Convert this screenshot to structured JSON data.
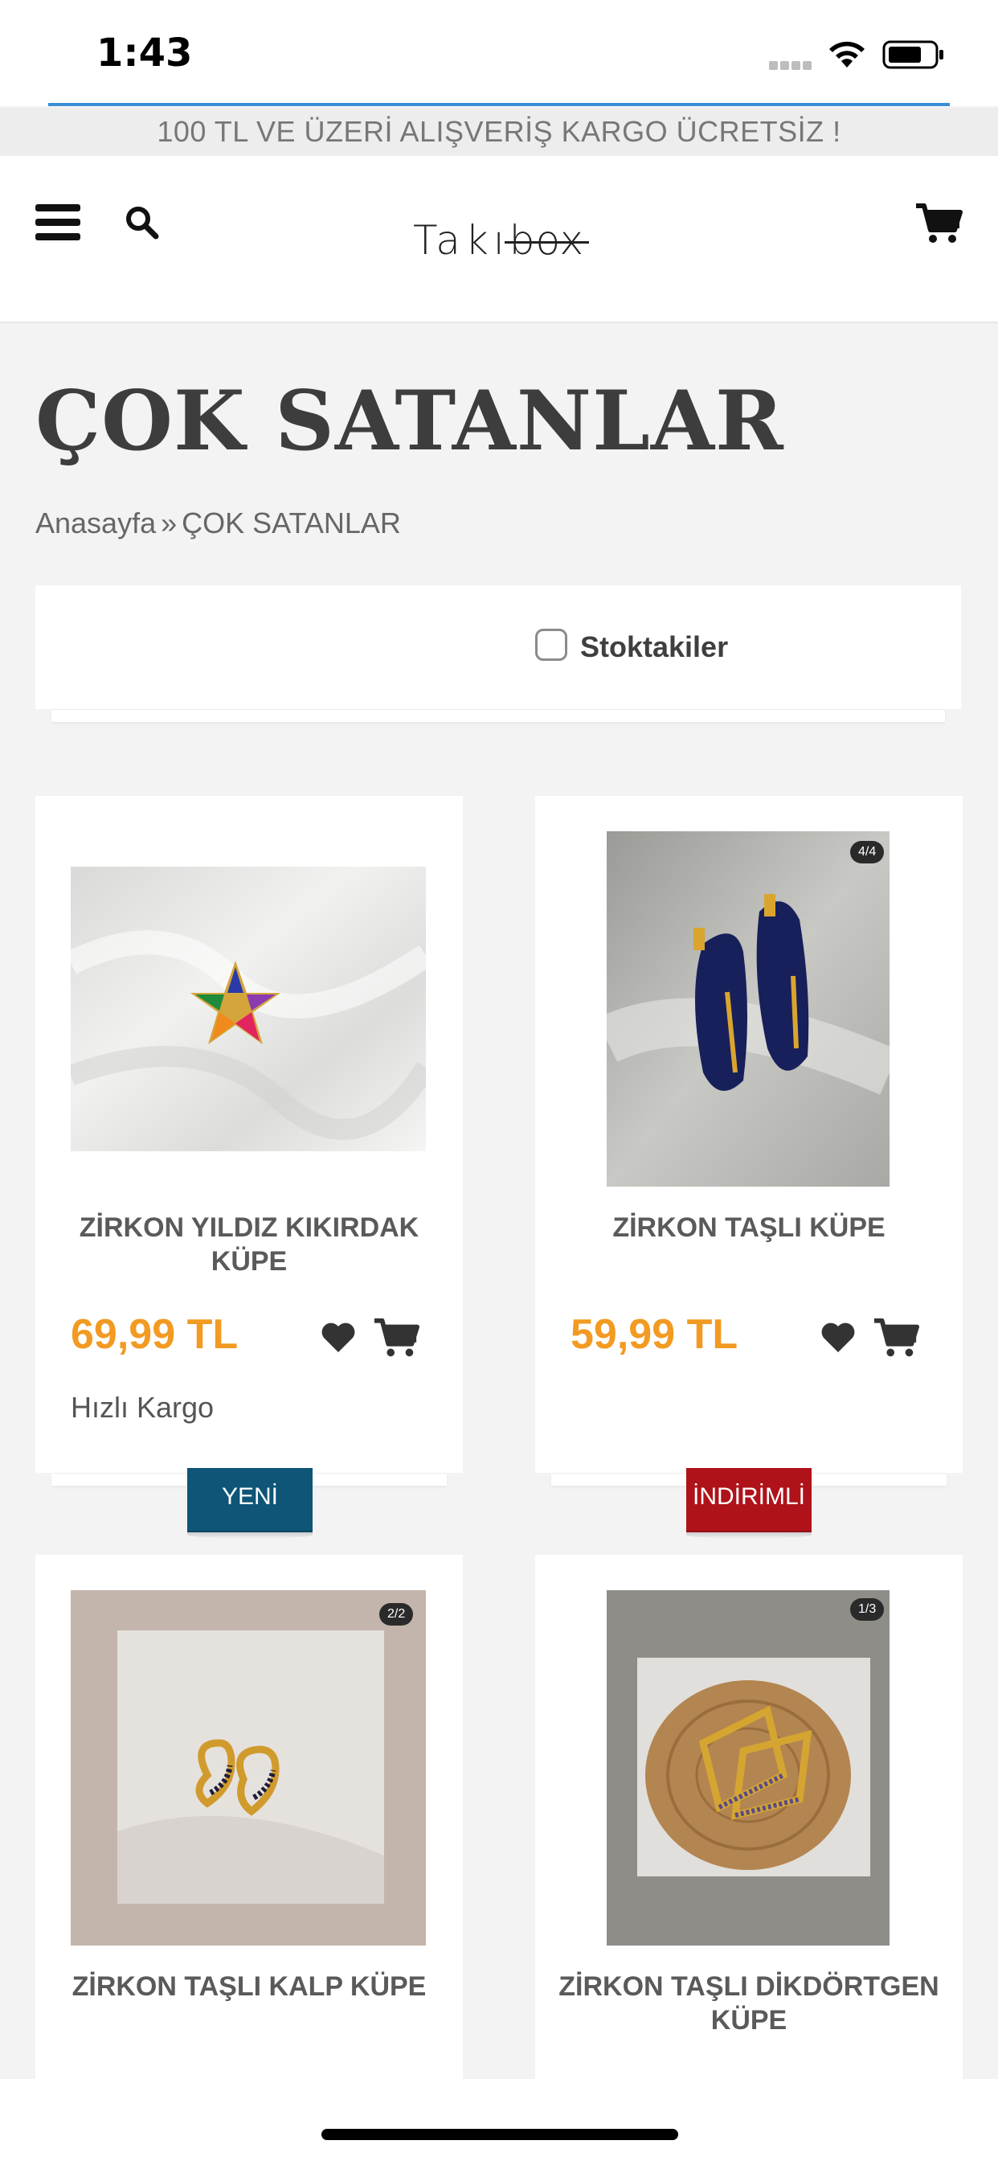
{
  "status_bar": {
    "time": "1:43"
  },
  "announcement": "100 TL VE ÜZERİ ALIŞVERİŞ KARGO ÜCRETSİZ !",
  "header": {
    "logo_main": "Takı",
    "logo_box": "box"
  },
  "page": {
    "title": "ÇOK SATANLAR"
  },
  "breadcrumb": {
    "home": "Anasayfa",
    "separator": "»",
    "current": "ÇOK SATANLAR"
  },
  "filter": {
    "in_stock_label": "Stoktakiler",
    "checked": false
  },
  "products": [
    {
      "name": "ZİRKON YILDIZ KIKIRDAK KÜPE",
      "price": "69,99 TL",
      "shipping": "Hızlı Kargo",
      "image_counter": ""
    },
    {
      "name": "ZİRKON TAŞLI KÜPE",
      "price": "59,99 TL",
      "shipping": "",
      "image_counter": "4/4"
    },
    {
      "name": "ZİRKON TAŞLI KALP KÜPE",
      "badge": "YENİ",
      "badge_color": "#0e5577",
      "image_counter": "2/2"
    },
    {
      "name": "ZİRKON TAŞLI DİKDÖRTGEN KÜPE",
      "badge": "İNDİRİMLİ",
      "badge_color": "#b0121a",
      "image_counter": "1/3"
    }
  ],
  "colors": {
    "price": "#f29a22",
    "accent_line": "#3a8ed6",
    "badge_new": "#0e5577",
    "badge_sale": "#b0121a"
  }
}
